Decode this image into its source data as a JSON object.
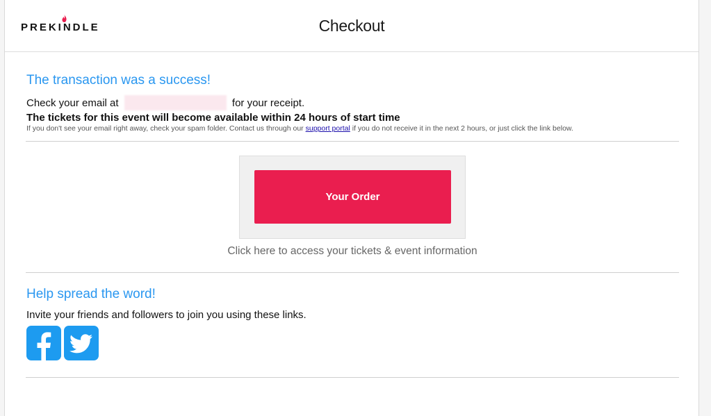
{
  "header": {
    "logo_text": "PREKINDLE",
    "title": "Checkout"
  },
  "confirmation": {
    "title": "The transaction was a success!",
    "email_prefix": "Check your email at",
    "email_suffix": "for your receipt.",
    "tickets_notice": "The tickets for this event will become available within 24 hours of start time",
    "spam_note_before": "If you don't see your email right away, check your spam folder. Contact us through our",
    "support_link": "support portal",
    "spam_note_after": "if you do not receive it in the next 2 hours, or just click the link below."
  },
  "order": {
    "button_label": "Your Order",
    "caption": "Click here to access your tickets & event information"
  },
  "share": {
    "title": "Help spread the word!",
    "text": "Invite your friends and followers to join you using these links.",
    "icons": [
      "facebook-icon",
      "twitter-icon"
    ]
  },
  "colors": {
    "accent_blue": "#2a97f0",
    "button_red": "#ea1e4f",
    "social_blue": "#1d9bf0",
    "flame_red": "#ea1e4f"
  }
}
